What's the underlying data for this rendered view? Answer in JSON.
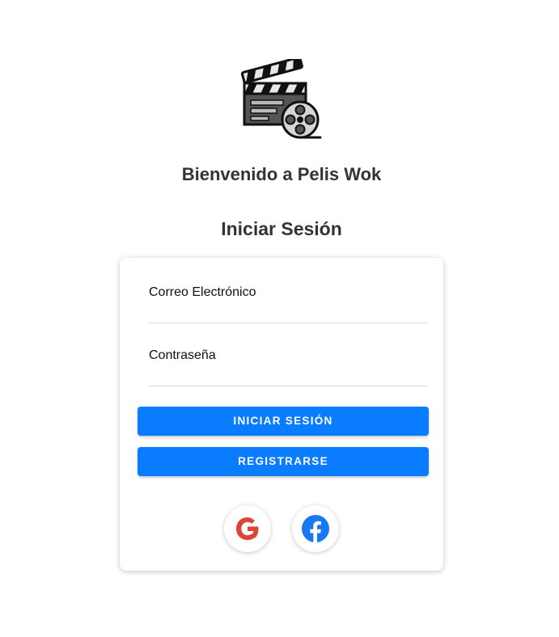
{
  "header": {
    "logo_icon": "clapperboard-film-reel-icon",
    "welcome_text": "Bienvenido a Pelis Wok",
    "login_title": "Iniciar Sesión"
  },
  "form": {
    "email_label": "Correo Electrónico",
    "email_value": "",
    "password_label": "Contraseña",
    "password_value": "",
    "login_button": "INICIAR SESIÓN",
    "register_button": "REGISTRARSE"
  },
  "social": {
    "google_icon": "google-icon",
    "facebook_icon": "facebook-icon"
  },
  "colors": {
    "primary": "#0a7cff",
    "heading": "#333333",
    "google_red": "#db4437",
    "facebook_blue": "#1877f2"
  }
}
